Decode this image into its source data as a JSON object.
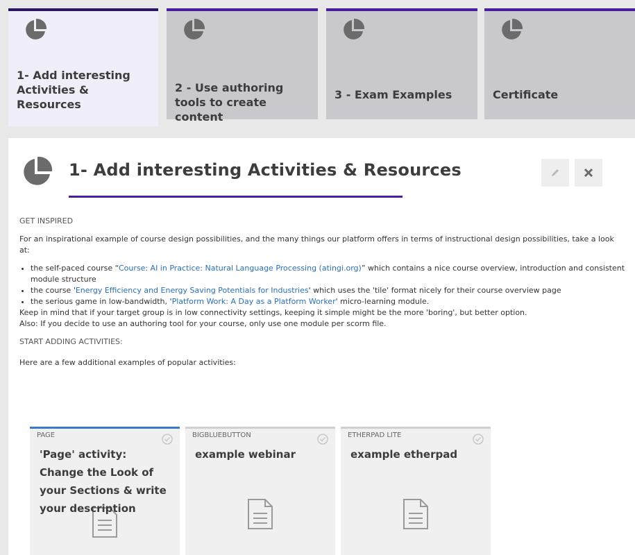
{
  "tabs": [
    {
      "title": "1- Add interesting Activities & Resources",
      "active": true
    },
    {
      "title": "2 - Use authoring tools to create content",
      "active": false
    },
    {
      "title": "3 - Exam Examples",
      "active": false
    },
    {
      "title": "Certificate",
      "active": false
    }
  ],
  "section": {
    "title": "1- Add interesting Activities & Resources",
    "icon": "pie-chart-icon",
    "edit_icon": "pencil-icon",
    "close_icon": "close-icon"
  },
  "content": {
    "get_inspired": "GET INSPIRED",
    "intro": "For an inspirational example of course design possibilities, and the many things our platform offers in terms of instructional design possibilities, take a look at:",
    "bullets": [
      {
        "pre": "the self-paced course “",
        "link": "Course: AI in Practice: Natural Language Processing (atingi.org)",
        "post": "” which contains a nice course overview, introduction and consistent module structure"
      },
      {
        "pre": "the course '",
        "link": "Energy Efficiency and Energy Saving Potentials for Industries",
        "post": "' which uses the 'tile' format nicely for their course overview page"
      },
      {
        "pre": "the serious game in low-bandwidth, '",
        "link": "Platform Work: A Day as a Platform Worker",
        "post": "' micro-learning module."
      }
    ],
    "note1": "Keep in mind that if your target group is in low connectivity settings, keeping it simple might be the more 'boring', but better option.",
    "note2": "Also: If you decide to use an authoring tool for your course, only use one module per scorm file.",
    "start_adding": "START ADDING ACTIVITIES:",
    "examples_intro": "Here are a few additional examples of popular activities:"
  },
  "cards": [
    {
      "kind": "PAGE",
      "name": "'Page' activity: Change the Look of your Sections & write your description",
      "icon": "document-icon"
    },
    {
      "kind": "BIGBLUEBUTTON",
      "name": "example webinar",
      "icon": "document-icon"
    },
    {
      "kind": "ETHERPAD LITE",
      "name": "example etherpad",
      "icon": "document-icon"
    }
  ],
  "colors": {
    "accent": "#4a1d9c",
    "link": "#2a6fb5",
    "active_card": "#3a78c9"
  }
}
